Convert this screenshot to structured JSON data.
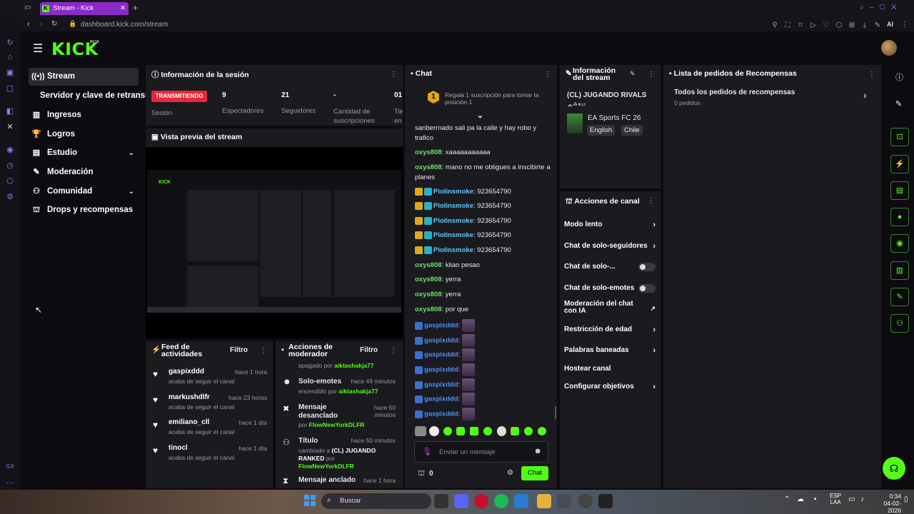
{
  "browser": {
    "tab_title": "Stream - Kick Dashboard",
    "url": "dashboard.kick.com/stream",
    "ai_label": "AI"
  },
  "brand": {
    "logo": "KICK",
    "beta": "BETA",
    "accent": "#53fc18"
  },
  "sidebar": {
    "items": [
      {
        "label": "Stream",
        "icon": "broadcast-icon"
      },
      {
        "label": "Servidor y clave de retransmisión",
        "icon": ""
      },
      {
        "label": "Ingresos",
        "icon": "chart-icon"
      },
      {
        "label": "Logros",
        "icon": "trophy-icon"
      },
      {
        "label": "Estudio",
        "icon": "studio-icon"
      },
      {
        "label": "Moderación",
        "icon": "wrench-icon"
      },
      {
        "label": "Comunidad",
        "icon": "community-icon"
      },
      {
        "label": "Drops y recompensas",
        "icon": "gift-icon"
      }
    ]
  },
  "session": {
    "title": "Información de la sesión",
    "live_badge": "TRANSMITIENDO",
    "stats": [
      {
        "value": "",
        "label": "Sesión"
      },
      {
        "value": "9",
        "label": "Espectadores"
      },
      {
        "value": "21",
        "label": "Seguidores"
      },
      {
        "value": "-",
        "label": "Cantidad de suscripciones"
      },
      {
        "value": "01",
        "label": "Tie en"
      }
    ]
  },
  "preview": {
    "title": "Vista previa del stream"
  },
  "feed": {
    "title": "Feed de actividades",
    "filter": "Filtro",
    "items": [
      {
        "name": "gaspixddd",
        "time": "hace 1 hora",
        "desc": "acaba de seguir el canal"
      },
      {
        "name": "markushdlfr",
        "time": "hace 23 horas",
        "desc": "acaba de seguir el canal"
      },
      {
        "name": "emiliano_cll",
        "time": "hace 1 día",
        "desc": "acaba de seguir el canal"
      },
      {
        "name": "tinocl",
        "time": "hace 1 día",
        "desc": "acaba de seguir el canal"
      }
    ]
  },
  "modactions": {
    "title": "Acciones de moderador",
    "filter": "Filtro",
    "items": [
      {
        "top": "apagado por",
        "top_user": "aiktashakja77"
      },
      {
        "name": "Solo-emotes",
        "time": "hace 49 minutos",
        "desc": "encendido por",
        "user": "aiktashakja77"
      },
      {
        "name": "Mensaje desanclado",
        "time": "hace 50 minutos",
        "desc": "por",
        "user": "FlowNewYorkDLFR"
      },
      {
        "name": "Título",
        "time": "hace 50 minutos",
        "desc": "cambiado a",
        "bold": "(CL) JUGANDO RANKED",
        "desc2": "por",
        "user": "FlowNewYorkDLFR"
      },
      {
        "name": "Mensaje anclado",
        "time": "hace 1 hora"
      }
    ]
  },
  "chat": {
    "title": "Chat",
    "promo": "Regala 1 suscripción para tomar la posición 1",
    "promo_num": "1",
    "messages": [
      {
        "user": "",
        "text": "sanberrnado sali pa la calle y hay robo y trafico"
      },
      {
        "user": "oxys808",
        "text": "xaaaaaaaaaaa"
      },
      {
        "user": "oxys808",
        "text": "mano no me obligues a inscibirte a planes"
      },
      {
        "user": "Piolinsmoke",
        "text": "923654790"
      },
      {
        "user": "Piolinsmoke",
        "text": "923654790"
      },
      {
        "user": "Piolinsmoke",
        "text": "923654790"
      },
      {
        "user": "Piolinsmoke",
        "text": "923654790"
      },
      {
        "user": "Piolinsmoke",
        "text": "923654790"
      },
      {
        "user": "oxys808",
        "text": "kliao pesao"
      },
      {
        "user": "oxys808",
        "text": "yerra"
      },
      {
        "user": "oxys808",
        "text": "yerra"
      },
      {
        "user": "oxys808",
        "text": "por que"
      },
      {
        "user": "gaspixddd",
        "text": ""
      },
      {
        "user": "gaspixddd",
        "text": ""
      },
      {
        "user": "gaspixddd",
        "text": ""
      },
      {
        "user": "gaspixddd",
        "text": ""
      },
      {
        "user": "gaspixddd",
        "text": ""
      },
      {
        "user": "gaspixddd",
        "text": ""
      },
      {
        "user": "gaspixddd",
        "text": ""
      }
    ],
    "placeholder": "Enviar un mensaje",
    "points": "0",
    "send": "Chat"
  },
  "streaminfo": {
    "title": "Información del stream",
    "stream_title": "(CL) JUGANDO RIVALS",
    "game": "EA Sports FC 26",
    "tags": [
      "English",
      "Chile"
    ]
  },
  "channel": {
    "title": "Acciones de canal",
    "items": [
      {
        "label": "Modo lento",
        "type": "arrow"
      },
      {
        "label": "Chat de solo-seguidores",
        "type": "arrow"
      },
      {
        "label": "Chat de solo-...",
        "type": "toggle"
      },
      {
        "label": "Chat de solo-emotes",
        "type": "toggle"
      },
      {
        "label": "Moderación del chat con IA",
        "type": "external"
      },
      {
        "label": "Restricción de edad",
        "type": "arrow"
      },
      {
        "label": "Palabras baneadas",
        "type": "arrow"
      },
      {
        "label": "Hostear canal",
        "type": "none"
      },
      {
        "label": "Configurar objetivos",
        "type": "arrow"
      }
    ]
  },
  "rewards": {
    "title": "Lista de pedidos de Recompensas",
    "all": "Todos los pedidos de recompensas",
    "count": "0 pedidos"
  },
  "taskbar": {
    "search": "Buscar",
    "lang": "ESP",
    "lang2": "LAA",
    "time": "0:34",
    "date": "04-02-2026"
  }
}
